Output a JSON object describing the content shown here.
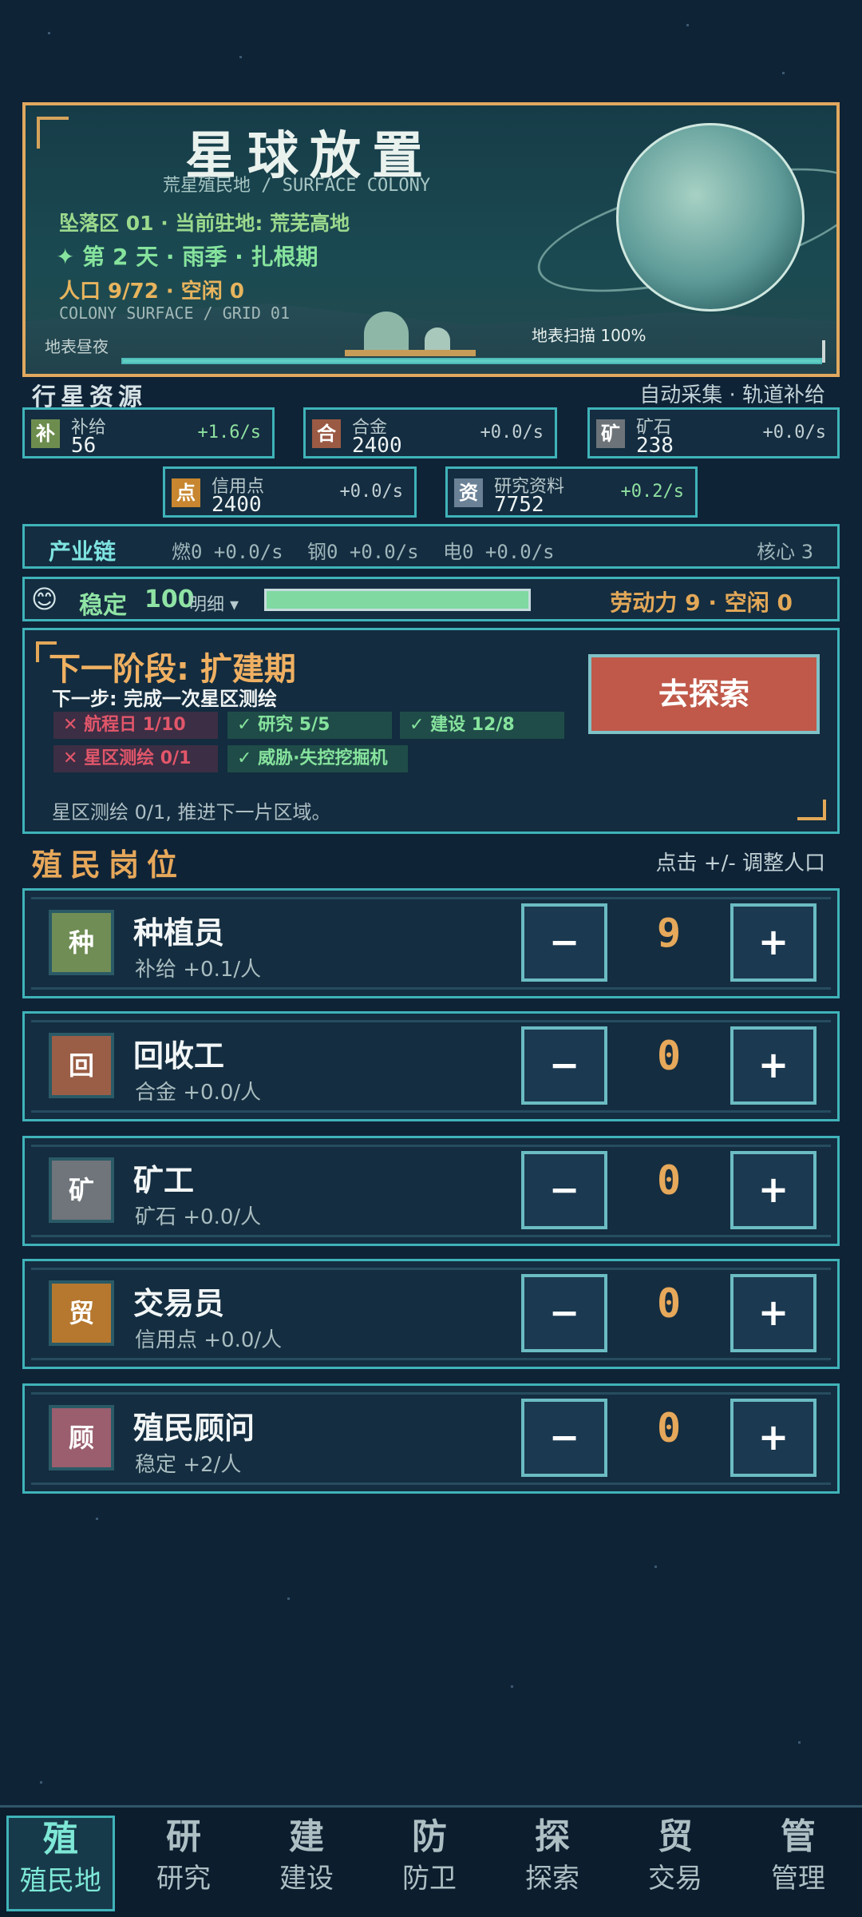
{
  "hero": {
    "title": "星球放置",
    "subtitle": "荒星殖民地 / SURFACE COLONY",
    "zone_line": "坠落区 01 · 当前驻地: 荒芜高地",
    "day_line": "✦ 第 2 天 · 雨季 · 扎根期",
    "population_line": "人口 9/72 · 空闲 0",
    "grid_line": "COLONY SURFACE / GRID 01",
    "day_night": "地表昼夜",
    "scan_label": "地表扫描 100%",
    "scan_progress": 1.0
  },
  "resources_section": {
    "title": "行星资源",
    "right_text": "自动采集 · 轨道补给"
  },
  "resources": [
    {
      "icon": "补",
      "label": "补给",
      "value": "56",
      "rate": "+1.6/s",
      "color": "#6d8d4f"
    },
    {
      "icon": "合",
      "label": "合金",
      "value": "2400",
      "rate": "+0.0/s",
      "color": "#9b5a44"
    },
    {
      "icon": "矿",
      "label": "矿石",
      "value": "238",
      "rate": "+0.0/s",
      "color": "#6d7479"
    },
    {
      "icon": "点",
      "label": "信用点",
      "value": "2400",
      "rate": "+0.0/s",
      "color": "#c7862f"
    },
    {
      "icon": "资",
      "label": "研究资料",
      "value": "7752",
      "rate": "+0.2/s",
      "color": "#6a8196"
    }
  ],
  "industry": {
    "label": "产业链",
    "fuel": "燃0 +0.0/s",
    "steel": "钢0 +0.0/s",
    "power": "电0 +0.0/s",
    "core": "核心 3"
  },
  "stability": {
    "emoji": "😊",
    "label": "稳定",
    "value": "100",
    "detail": "明细 ▾",
    "level": 1.0,
    "labor": "劳动力 9 · 空闲 0"
  },
  "phase": {
    "title": "下一阶段: 扩建期",
    "next_step": "下一步: 完成一次星区测绘",
    "chips": [
      {
        "text": "✕ 航程日 1/10",
        "ok": false
      },
      {
        "text": "✓ 研究 5/5",
        "ok": true
      },
      {
        "text": "✓ 建设 12/8",
        "ok": true
      },
      {
        "text": "✕ 星区测绘 0/1",
        "ok": false
      },
      {
        "text": "✓ 威胁·失控挖掘机",
        "ok": true
      }
    ],
    "button": "去探索",
    "note": "星区测绘 0/1, 推进下一片区域。"
  },
  "jobs_section": {
    "title": "殖民岗位",
    "hint": "点击 +/- 调整人口"
  },
  "jobs": [
    {
      "icon": "种",
      "name": "种植员",
      "desc": "补给 +0.1/人",
      "count": "9",
      "color": "#6f8d55"
    },
    {
      "icon": "回",
      "name": "回收工",
      "desc": "合金 +0.0/人",
      "count": "0",
      "color": "#9a5e46"
    },
    {
      "icon": "矿",
      "name": "矿工",
      "desc": "矿石 +0.0/人",
      "count": "0",
      "color": "#6f757b"
    },
    {
      "icon": "贸",
      "name": "交易员",
      "desc": "信用点 +0.0/人",
      "count": "0",
      "color": "#b6782e"
    },
    {
      "icon": "顾",
      "name": "殖民顾问",
      "desc": "稳定 +2/人",
      "count": "0",
      "color": "#9a5e6e"
    }
  ],
  "job_controls": {
    "minus": "−",
    "plus": "+"
  },
  "nav": [
    {
      "glyph": "殖",
      "label": "殖民地",
      "active": true
    },
    {
      "glyph": "研",
      "label": "研究",
      "active": false
    },
    {
      "glyph": "建",
      "label": "建设",
      "active": false
    },
    {
      "glyph": "防",
      "label": "防卫",
      "active": false
    },
    {
      "glyph": "探",
      "label": "探索",
      "active": false
    },
    {
      "glyph": "贸",
      "label": "交易",
      "active": false
    },
    {
      "glyph": "管",
      "label": "管理",
      "active": false
    }
  ]
}
